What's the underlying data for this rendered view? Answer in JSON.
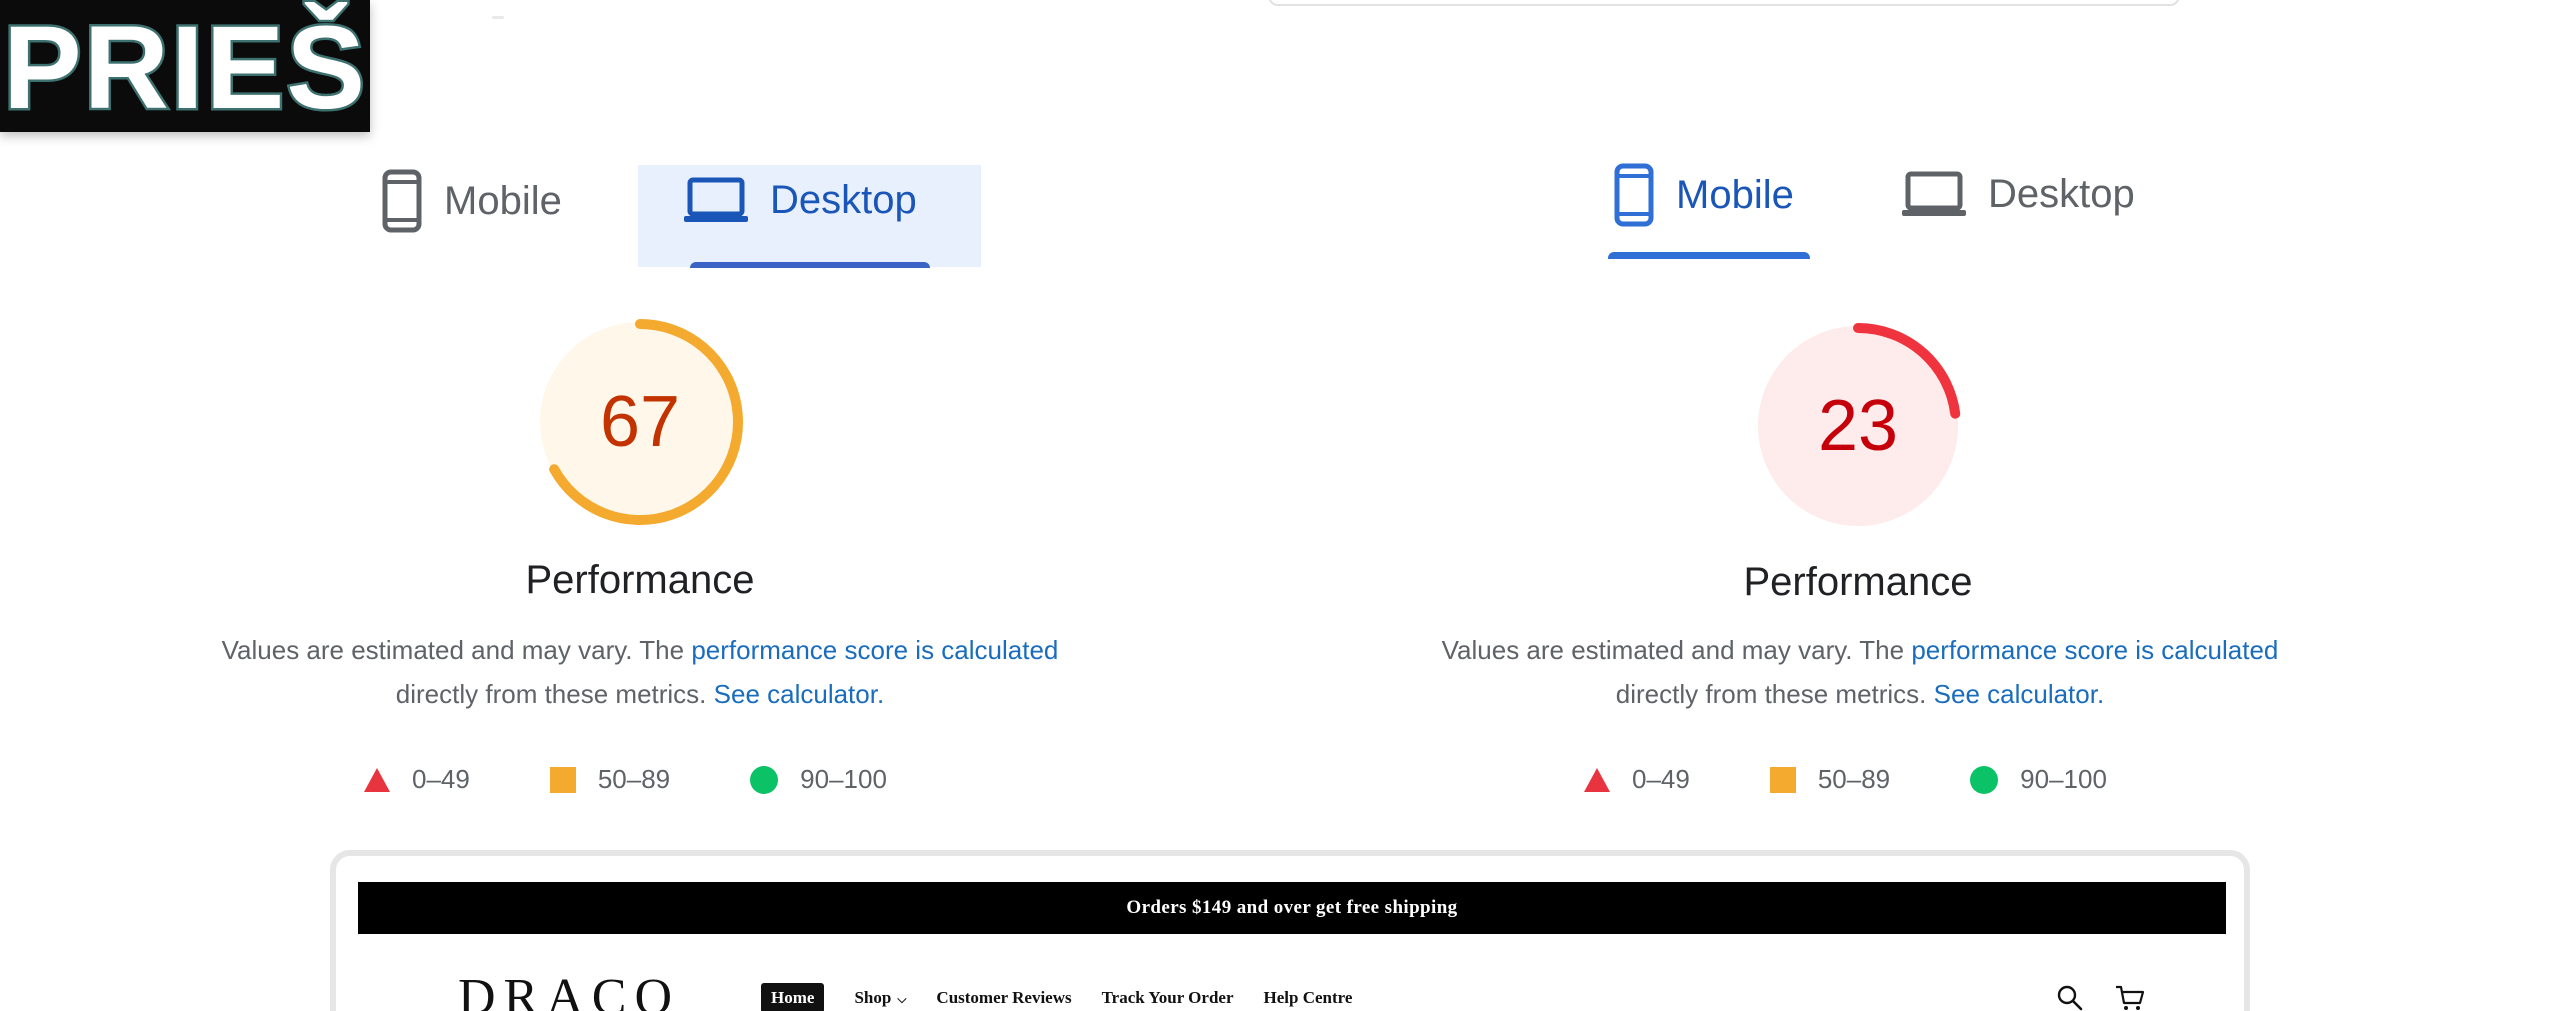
{
  "overlay": {
    "label": "PRIEŠ"
  },
  "left": {
    "tabs": [
      {
        "label": "Mobile",
        "active": false,
        "icon": "smartphone-icon"
      },
      {
        "label": "Desktop",
        "active": true,
        "icon": "laptop-icon"
      }
    ],
    "score": "67",
    "score_fraction": 0.67,
    "score_color": "#c33300",
    "ring_color": "#f4a92f",
    "ring_bg": "#fff8ea",
    "title": "Performance",
    "desc_pre": "Values are estimated and may vary. The ",
    "desc_link1": "performance score is calculated",
    "desc_mid": "directly from these metrics. ",
    "desc_link2": "See calculator.",
    "legend": [
      "0–49",
      "50–89",
      "90–100"
    ]
  },
  "right": {
    "tabs": [
      {
        "label": "Mobile",
        "active": true,
        "icon": "smartphone-icon"
      },
      {
        "label": "Desktop",
        "active": false,
        "icon": "laptop-icon"
      }
    ],
    "score": "23",
    "score_fraction": 0.23,
    "score_color": "#c5000b",
    "ring_color": "#f0343f",
    "ring_bg": "#fdeceb",
    "title": "Performance",
    "desc_pre": "Values are estimated and may vary. The ",
    "desc_link1": "performance score is calculated",
    "desc_mid": "directly from these metrics. ",
    "desc_link2": "See calculator.",
    "legend": [
      "0–49",
      "50–89",
      "90–100"
    ]
  },
  "store": {
    "announcement": "Orders $149 and over get free shipping",
    "logo": "DRACO",
    "nav": [
      "Home",
      "Shop",
      "Customer Reviews",
      "Track Your Order",
      "Help Centre"
    ],
    "icons": [
      "search-icon",
      "cart-icon"
    ]
  }
}
